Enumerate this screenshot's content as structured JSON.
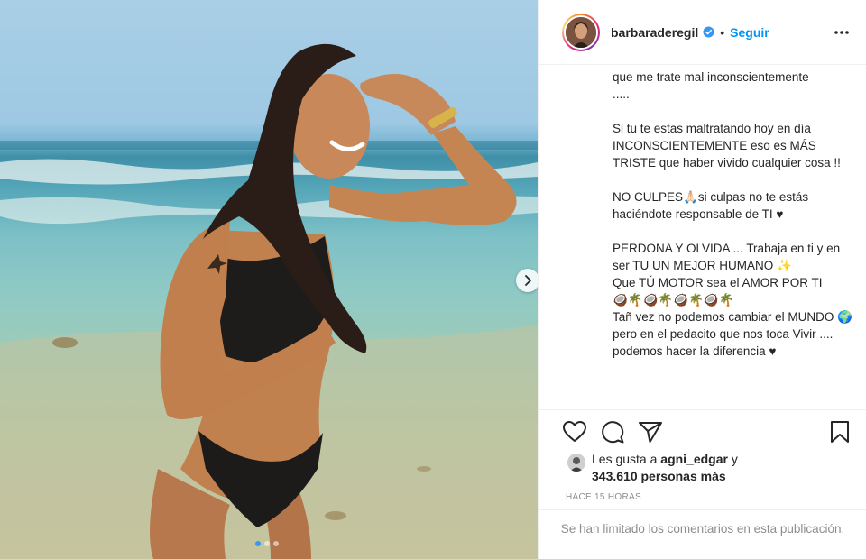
{
  "post": {
    "username": "barbaraderegil",
    "separator": "•",
    "follow_label": "Seguir",
    "caption": [
      "que me trate mal inconscientemente\n.....",
      "Si tu te estas maltratando hoy en día INCONSCIENTEMENTE eso es MÁS TRISTE que haber vivido cualquier cosa !!",
      "NO CULPES🙏🏻si culpas no te estás haciéndote responsable de TI ♥",
      "PERDONA Y OLVIDA ... Trabaja en ti y en ser TU UN MEJOR HUMANO ✨\nQue TÚ MOTOR sea el AMOR POR TI\n🥥🌴🥥🌴🥥🌴🥥🌴\nTañ vez no podemos cambiar el MUNDO 🌍pero en el pedacito que nos toca Vivir ....\npodemos hacer la diferencia ♥"
    ],
    "likes_prefix": "Les gusta a ",
    "likes_user": "agni_edgar",
    "likes_suffix": " y",
    "likes_count": "343.610 personas más",
    "timestamp": "HACE 15 HORAS",
    "comments_limited": "Se han limitado los comentarios en esta publicación."
  },
  "icons": {
    "verified": "verified-badge-icon",
    "more": "more-options-icon",
    "like": "heart-icon",
    "comment": "comment-bubble-icon",
    "share": "paper-plane-icon",
    "save": "bookmark-icon",
    "next": "chevron-right-icon"
  },
  "carousel": {
    "slides": 3,
    "active_index": 0
  },
  "colors": {
    "accent": "#0095f6",
    "text": "#262626",
    "muted": "#8e8e8e",
    "border": "#efefef"
  }
}
